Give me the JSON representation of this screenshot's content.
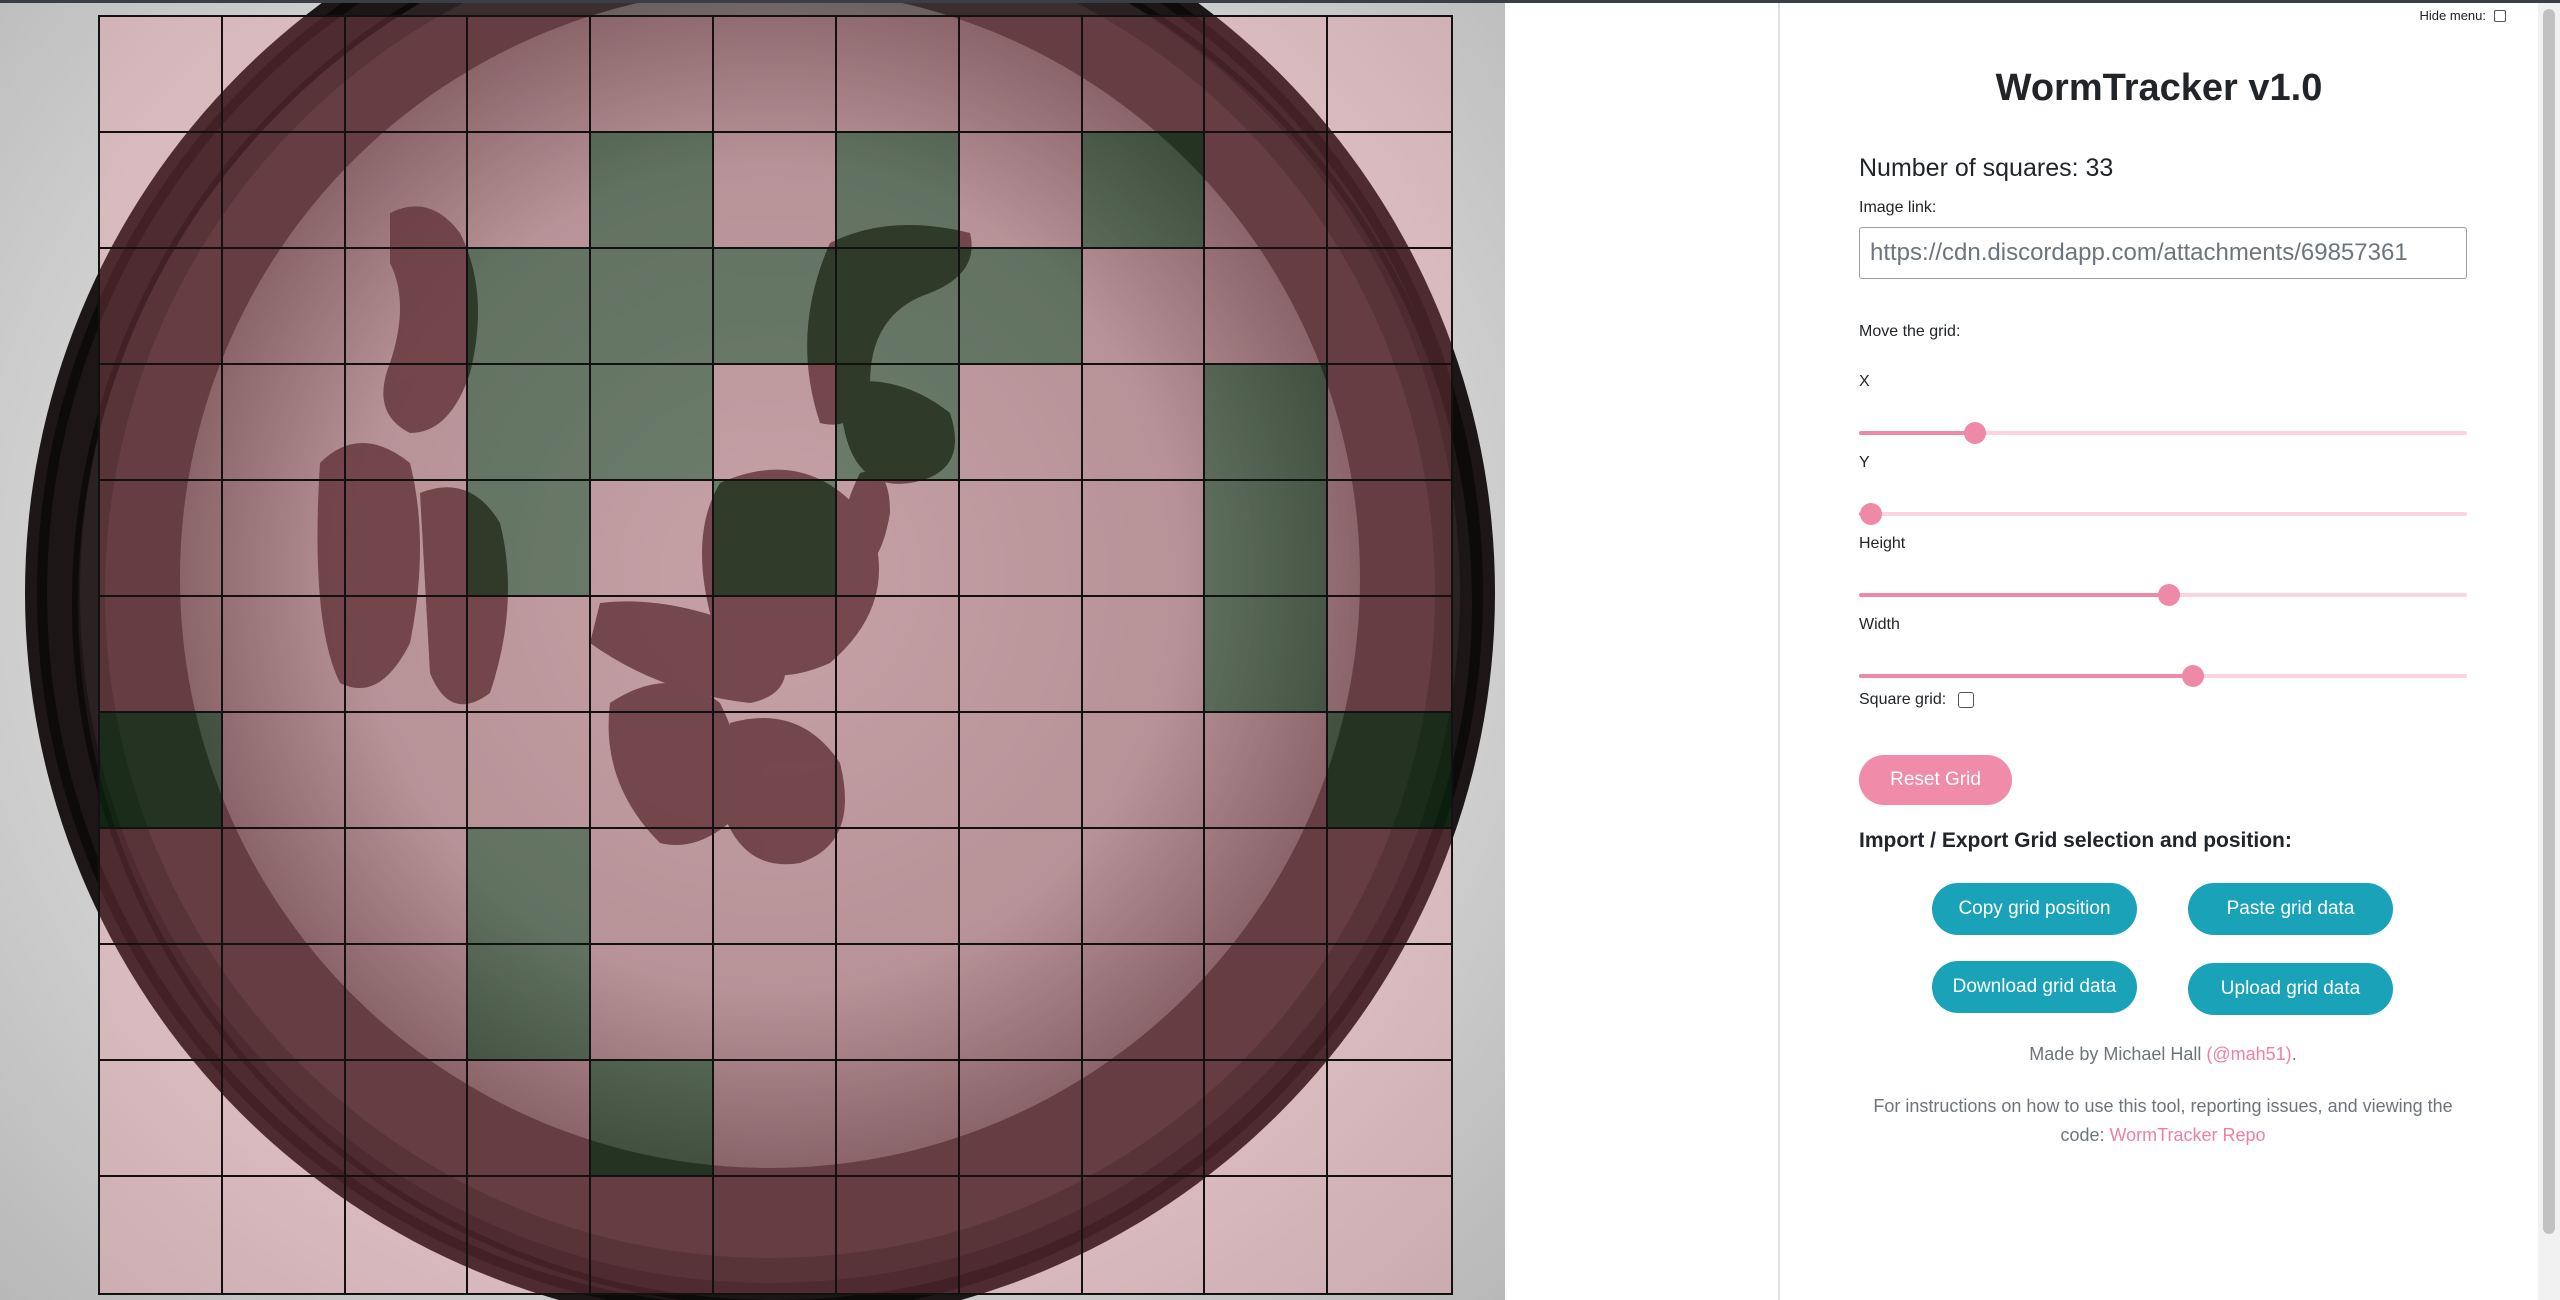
{
  "panel": {
    "hide_menu_label": "Hide menu:",
    "title": "WormTracker v1.0",
    "count_label": "Number of squares: 33",
    "image_link_label": "Image link:",
    "image_link_value": "https://cdn.discordapp.com/attachments/69857361",
    "move_grid_label": "Move the grid:",
    "sliders": [
      {
        "label": "X",
        "value_percent": 19
      },
      {
        "label": "Y",
        "value_percent": 2
      },
      {
        "label": "Height",
        "value_percent": 51
      },
      {
        "label": "Width",
        "value_percent": 55
      }
    ],
    "square_grid_label": "Square grid:",
    "reset_button": "Reset Grid",
    "import_export_heading": "Import / Export Grid selection and position:",
    "buttons": {
      "copy": "Copy grid position",
      "paste": "Paste grid data",
      "download": "Download grid data",
      "upload": "Upload grid data"
    },
    "credit_prefix": "Made by Michael Hall ",
    "credit_link": "(@mah51)",
    "credit_suffix": ".",
    "instructions_text": "For instructions on how to use this tool, reporting issues, and viewing the code: ",
    "instructions_link": "WormTracker Repo"
  },
  "grid": {
    "rows": 11,
    "cols": 11,
    "selected": [
      "...........",
      "....#.#.#..",
      "...#####...",
      "...##.#..#.",
      "...#.#...#.",
      ".........#.",
      "#.........#",
      "...#.......",
      "...#.......",
      "....#......",
      "..........."
    ]
  },
  "colors": {
    "accent_pink": "#f08ba9",
    "button_teal": "#1aa2b8",
    "selected_cell": "#0a3c14",
    "unselected_cell": "#ff788c"
  }
}
